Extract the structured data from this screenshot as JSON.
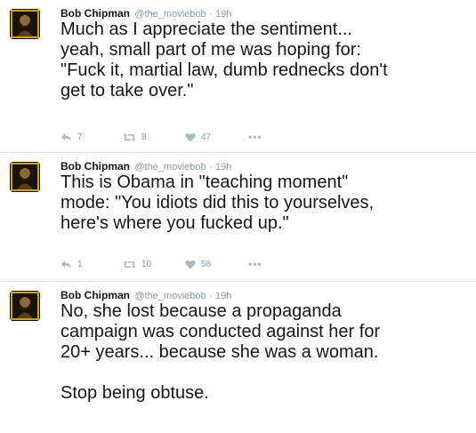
{
  "tweets": [
    {
      "name": "Bob Chipman",
      "handle": "@the_moviebob",
      "separator": "·",
      "time": "19h",
      "text": "Much as I appreciate the sentiment...\nyeah, small part of me was hoping for:\n\"Fuck it, martial law, dumb rednecks don't\nget to take over.\"",
      "replies": "7",
      "retweets": "8",
      "likes": "47",
      "more": "•••"
    },
    {
      "name": "Bob Chipman",
      "handle": "@the_moviebob",
      "separator": "·",
      "time": "19h",
      "text": "This is Obama in \"teaching moment\"\nmode: \"You idiots did this to yourselves,\nhere's where you fucked up.\"",
      "replies": "1",
      "retweets": "10",
      "likes": "58",
      "more": "•••"
    },
    {
      "name": "Bob Chipman",
      "handle": "@the_moviebob",
      "separator": "·",
      "time": "19h",
      "text": "No, she lost because a propaganda\ncampaign was conducted against her for\n20+ years... because she was a woman.\n\nStop being obtuse.",
      "replies": "",
      "retweets": "",
      "likes": "",
      "more": ""
    }
  ],
  "icons": {
    "reply": "reply-icon",
    "retweet": "retweet-icon",
    "like": "heart-icon",
    "more": "more-icon"
  },
  "colors": {
    "text": "#14171a",
    "muted": "#8899a6",
    "border": "#e1e8ed",
    "avatar_bg": "#1a1408",
    "avatar_frame": "#c9a227"
  }
}
